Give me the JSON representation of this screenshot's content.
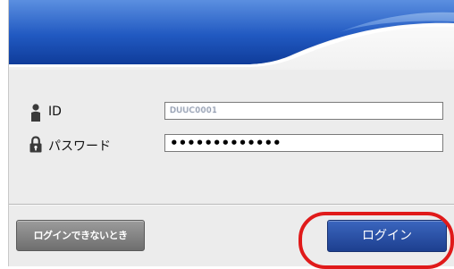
{
  "form": {
    "id_label": "ID",
    "id_value": "DUUC0001",
    "password_label": "パスワード",
    "password_value": "•••••••••••••"
  },
  "buttons": {
    "cannot_login_label": "ログインできないとき",
    "login_label": "ログイン"
  },
  "icons": {
    "id_icon": "person-icon",
    "password_icon": "lock-icon"
  },
  "colors": {
    "header_blue": "#1f56b8",
    "login_button": "#2a4ea6",
    "help_button": "#858585",
    "highlight": "#e01a1a"
  }
}
